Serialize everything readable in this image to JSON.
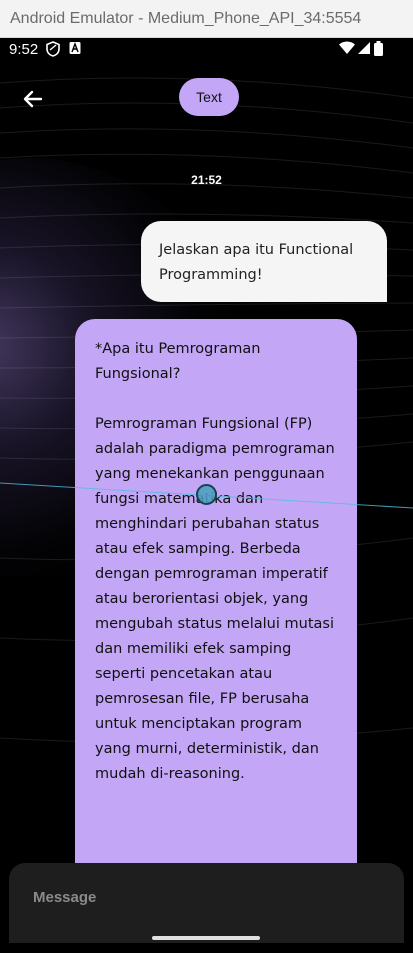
{
  "window": {
    "title": "Android Emulator - Medium_Phone_API_34:5554"
  },
  "statusbar": {
    "time": "9:52"
  },
  "appbar": {
    "back_icon": "arrow-left-icon",
    "mode_chip_label": "Text"
  },
  "chat": {
    "timestamp": "21:52",
    "user_message": "Jelaskan apa itu Functional Programming!",
    "ai_message": "*Apa itu Pemrograman Fungsional?\n\nPemrograman Fungsional (FP) adalah paradigma pemrograman yang menekankan penggunaan fungsi matematika dan menghindari perubahan status atau efek samping. Berbeda dengan pemrograman imperatif atau berorientasi objek, yang mengubah status melalui mutasi dan memiliki efek samping seperti pencetakan atau pemrosesan file, FP berusaha untuk menciptakan program yang murni, deterministik, dan mudah di-reasoning."
  },
  "composer": {
    "placeholder": "Message"
  },
  "colors": {
    "accent": "#c4a6f7",
    "user_bubble": "#f5f5f5",
    "background": "#000000",
    "composer": "#1e1e1e"
  }
}
